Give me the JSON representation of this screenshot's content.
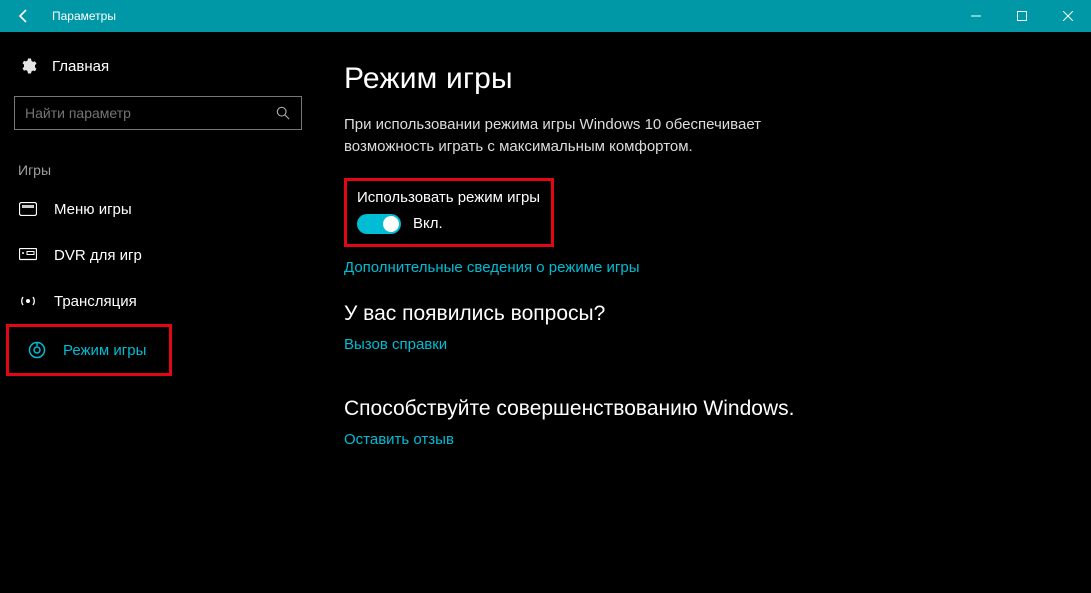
{
  "titlebar": {
    "title": "Параметры"
  },
  "sidebar": {
    "home_label": "Главная",
    "search_placeholder": "Найти параметр",
    "section_label": "Игры",
    "items": [
      {
        "label": "Меню игры"
      },
      {
        "label": "DVR для игр"
      },
      {
        "label": "Трансляция"
      },
      {
        "label": "Режим игры"
      }
    ]
  },
  "content": {
    "title": "Режим игры",
    "description": "При использовании режима игры Windows 10 обеспечивает возможность играть с максимальным комфортом.",
    "toggle_label": "Использовать режим игры",
    "toggle_state": "Вкл.",
    "link_learnmore": "Дополнительные сведения о режиме игры",
    "questions_heading": "У вас появились вопросы?",
    "link_help": "Вызов справки",
    "feedback_heading": "Способствуйте совершенствованию Windows.",
    "link_feedback": "Оставить отзыв"
  }
}
